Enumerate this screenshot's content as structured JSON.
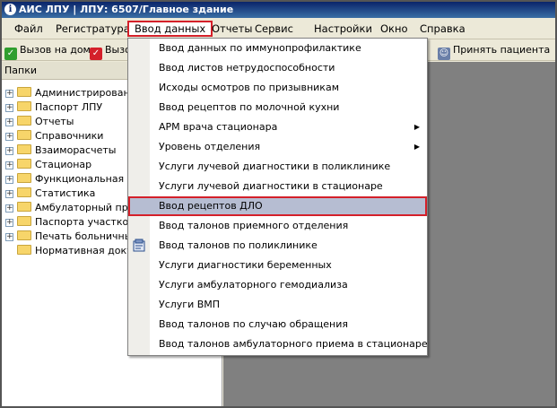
{
  "window": {
    "title": "АИС ЛПУ | ЛПУ: 6507/Главное здание",
    "icon": "app-info-icon"
  },
  "menubar": {
    "items": [
      "Файл",
      "Регистратура",
      "Ввод данных",
      "Отчеты",
      "Сервис",
      "Настройки",
      "Окно",
      "Справка"
    ],
    "active_index": 2
  },
  "toolbar": {
    "home_call": "Вызов на дом",
    "second_call": "Вызо",
    "accept_patient": "Принять пациента"
  },
  "sidebar": {
    "header": "Папки",
    "items": [
      "Администрирование",
      "Паспорт ЛПУ",
      "Отчеты",
      "Справочники",
      "Взаиморасчеты",
      "Стационар",
      "Функциональная ди",
      "Статистика",
      "Амбулаторный прие",
      "Паспорта участков",
      "Печать больничных",
      "Нормативная докум"
    ]
  },
  "dropdown": {
    "items": [
      "Ввод данных по иммунопрофилактике",
      "Ввод листов нетрудоспособности",
      "Исходы осмотров по призывникам",
      "Ввод рецептов по молочной кухни",
      "АРМ врача стационара",
      "Уровень отделения",
      "Услуги лучевой диагностики в поликлинике",
      "Услуги лучевой диагностики в стационаре",
      "Ввод рецептов ДЛО",
      "Ввод талонов приемного отделения",
      "Ввод талонов по поликлинике",
      "Услуги диагностики беременных",
      "Услуги амбулаторного гемодиализа",
      "Услуги ВМП",
      "Ввод талонов по случаю обращения",
      "Ввод талонов амбулаторного приема в стационаре"
    ],
    "submenu_indices": [
      4,
      5
    ],
    "highlighted_index": 8,
    "icon_index": 10
  },
  "colors": {
    "highlight_border": "#d4202a",
    "highlight_bg": "#b6bdd2",
    "titlebar": "#0a246a"
  }
}
